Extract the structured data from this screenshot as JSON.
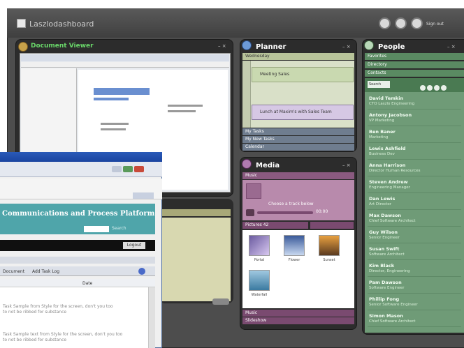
{
  "app": {
    "brand": "Laszlo",
    "product": "dashboard"
  },
  "header": {
    "signout": "Sign out"
  },
  "panels": {
    "docs": {
      "title": "Document Viewer"
    },
    "planner": {
      "title": "Planner",
      "section": "Wednesday",
      "items": [
        "Meeting Sales",
        "Lunch at Maxim's with Sales Team"
      ],
      "footer": [
        "My Tasks",
        "My New Tasks",
        "Calendar"
      ]
    },
    "media": {
      "title": "Media",
      "tab": "Music",
      "track": "Choose a track below",
      "time": "00:00",
      "category": "Pictures 42",
      "thumbs": [
        "Portal",
        "Flower",
        "Sunset",
        "Waterfall"
      ],
      "footer": [
        "Music",
        "Slideshow"
      ]
    },
    "people": {
      "title": "People",
      "nav": [
        "Favorites",
        "Directory",
        "Contacts"
      ],
      "search": "Search",
      "contacts": [
        {
          "name": "David Temkin",
          "role": "CTO Laszlo Engineering"
        },
        {
          "name": "Antony Jacobson",
          "role": "VP Marketing"
        },
        {
          "name": "Ben Baner",
          "role": "Marketing"
        },
        {
          "name": "Lewis Ashfield",
          "role": "Business Dev"
        },
        {
          "name": "Anna Harrison",
          "role": "Director Human Resources"
        },
        {
          "name": "Steven Andrew",
          "role": "Engineering Manager"
        },
        {
          "name": "Dan Lewis",
          "role": "Art Director"
        },
        {
          "name": "Max Dawson",
          "role": "Chief Software Architect"
        },
        {
          "name": "Guy Wilson",
          "role": "Senior Engineer"
        },
        {
          "name": "Susan Swift",
          "role": "Software Architect"
        },
        {
          "name": "Kim Black",
          "role": "Director, Engineering"
        },
        {
          "name": "Pam Dawson",
          "role": "Software Engineer"
        },
        {
          "name": "Phillip Fong",
          "role": "Senior Software Engineer"
        },
        {
          "name": "Simon Mason",
          "role": "Chief Software Architect"
        }
      ]
    }
  },
  "overlay": {
    "title": "Communications and Process Platform",
    "search_btn": "Search",
    "logout": "Logout",
    "tabs": [
      "Document",
      "Add Task Log",
      "Date"
    ],
    "row1": "Task Sample from Style for the screen, don't you too",
    "row1b": "to not be ribbed for substance",
    "row2": "Task Sample text from Style for the screen, don't you too",
    "row2b": "to not be ribbed for substance"
  },
  "colors": {
    "planner": "#c9d9b0",
    "media": "#a9799a",
    "people": "#6f9b77",
    "overlay_header": "#4fa5aa"
  }
}
